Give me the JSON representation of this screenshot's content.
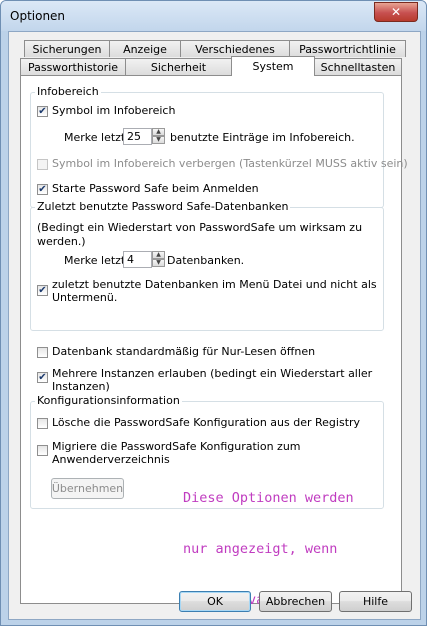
{
  "window": {
    "title": "Optionen",
    "close_label": "✕"
  },
  "tabs": {
    "row1": [
      "Sicherungen",
      "Anzeige",
      "Verschiedenes",
      "Passwortrichtlinie"
    ],
    "row2": [
      "Passworthistorie",
      "Sicherheit",
      "System",
      "Schnelltasten"
    ],
    "active": "System"
  },
  "infobereich": {
    "title": "Infobereich",
    "symbol_label": "Symbol im Infobereich",
    "symbol_checked": true,
    "merke_prefix": "Merke letzte",
    "merke_value": "25",
    "merke_suffix": "benutzte Einträge im Infobereich.",
    "verbergen_label": "Symbol im Infobereich verbergen (Tastenkürzel MUSS aktiv sein)",
    "verbergen_checked": false,
    "starte_label": "Starte Password Safe beim Anmelden",
    "starte_checked": true
  },
  "zuletzt": {
    "title": "Zuletzt benutzte Password Safe-Datenbanken",
    "note_line1": "(Bedingt ein Wiederstart von PasswordSafe um wirksam zu",
    "note_line2": "werden.)",
    "merke_prefix": "Merke letzte",
    "merke_value": "4",
    "merke_suffix": "Datenbanken.",
    "submenu_line1": "zuletzt benutzte Datenbanken im Menü Datei und nicht als",
    "submenu_line2": "Untermenü.",
    "submenu_checked": true
  },
  "options": {
    "readonly_label": "Datenbank standardmäßig für Nur-Lesen öffnen",
    "readonly_checked": false,
    "multi_line1": "Mehrere Instanzen erlauben (bedingt ein Wiederstart aller",
    "multi_line2": "Instanzen)",
    "multi_checked": true
  },
  "konfig": {
    "title": "Konfigurationsinformation",
    "delete_label": "Lösche die PasswordSafe Konfiguration aus der Registry",
    "delete_checked": false,
    "migrate_line1": "Migriere die PasswordSafe Konfiguration zum",
    "migrate_line2": "Anwenderverzeichnis",
    "migrate_checked": false,
    "apply_label": "Übernehmen"
  },
  "annotation": {
    "line1": "Diese Optionen werden",
    "line2": "nur angezeigt, wenn",
    "line3": "sie relevant sind.",
    "color": "#c03cc0"
  },
  "buttons": {
    "ok": "OK",
    "cancel": "Abbrechen",
    "help": "Hilfe"
  },
  "icons": {
    "checkmark": "✔",
    "spin_up": "▲",
    "spin_down": "▼"
  }
}
